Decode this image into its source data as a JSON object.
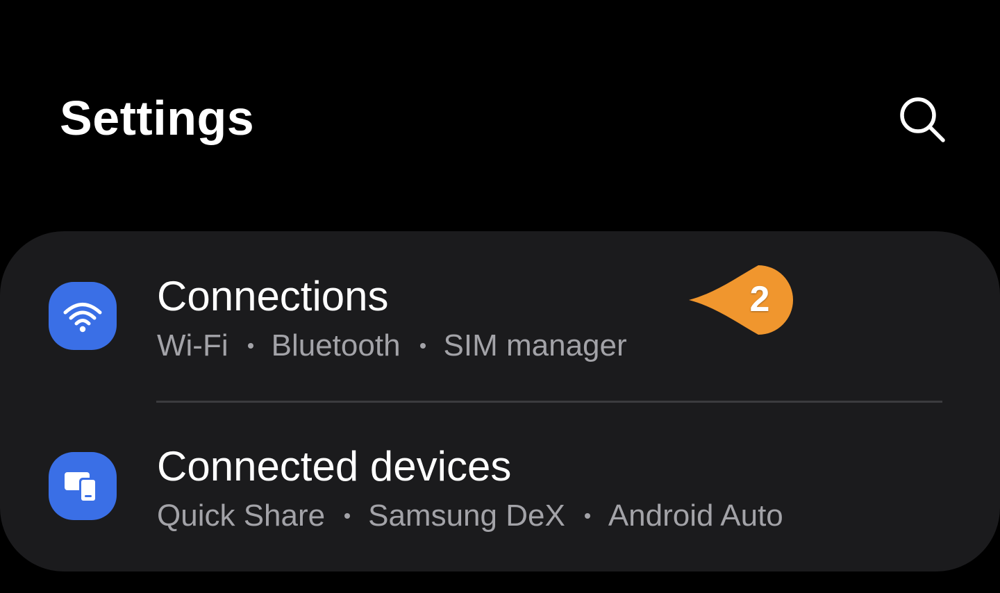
{
  "header": {
    "title": "Settings",
    "search_icon": "search-icon"
  },
  "settings_list": [
    {
      "title": "Connections",
      "icon": "wifi-icon",
      "subtitle_items": [
        "Wi-Fi",
        "Bluetooth",
        "SIM manager"
      ]
    },
    {
      "title": "Connected devices",
      "icon": "connected-devices-icon",
      "subtitle_items": [
        "Quick Share",
        "Samsung DeX",
        "Android Auto"
      ]
    }
  ],
  "annotation": {
    "step_number": "2",
    "color": "#f0962e"
  },
  "colors": {
    "background": "#000000",
    "card": "#1b1b1d",
    "icon_background": "#3a6fe6",
    "subtitle_text": "#a3a3a8",
    "divider": "#3b3b3e"
  }
}
